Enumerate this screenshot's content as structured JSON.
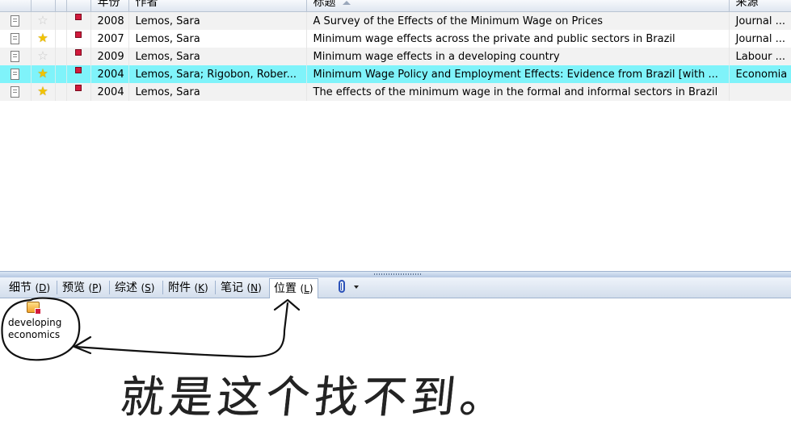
{
  "table": {
    "columns": {
      "year": "年份",
      "author": "作者",
      "title": "标题",
      "source": "来源"
    },
    "rows": [
      {
        "starred": false,
        "year": "2008",
        "author": "Lemos, Sara",
        "title": "A Survey of the Effects of the Minimum Wage on Prices",
        "source": "Journal ..."
      },
      {
        "starred": true,
        "year": "2007",
        "author": "Lemos, Sara",
        "title": "Minimum wage effects across the private and public sectors in Brazil",
        "source": "Journal ..."
      },
      {
        "starred": false,
        "year": "2009",
        "author": "Lemos, Sara",
        "title": "Minimum wage effects in a developing country",
        "source": "Labour ..."
      },
      {
        "starred": true,
        "year": "2004",
        "author": "Lemos, Sara; Rigobon, Rober...",
        "title": "Minimum Wage Policy and Employment Effects: Evidence from Brazil [with ...",
        "source": "Economia",
        "selected": true
      },
      {
        "starred": true,
        "year": "2004",
        "author": "Lemos, Sara",
        "title": "The effects of the minimum wage in the formal and informal sectors in Brazil",
        "source": ""
      }
    ]
  },
  "tabs": [
    {
      "label": "细节",
      "key": "D"
    },
    {
      "label": "预览",
      "key": "P"
    },
    {
      "label": "综述",
      "key": "S"
    },
    {
      "label": "附件",
      "key": "K"
    },
    {
      "label": "笔记",
      "key": "N"
    },
    {
      "label": "位置",
      "key": "L",
      "active": true
    }
  ],
  "location": {
    "label": "developing economics"
  },
  "annotation": {
    "text": "就是这个找不到。"
  },
  "colors": {
    "selected_row": "#7ff3fa",
    "flag": "#d21a3c",
    "star_on": "#f2c300",
    "ink": "#111111"
  },
  "icons": [
    "document-icon",
    "star-icon",
    "flag-icon",
    "paperclip-icon",
    "dropdown-arrow-icon",
    "location-folder-icon"
  ]
}
